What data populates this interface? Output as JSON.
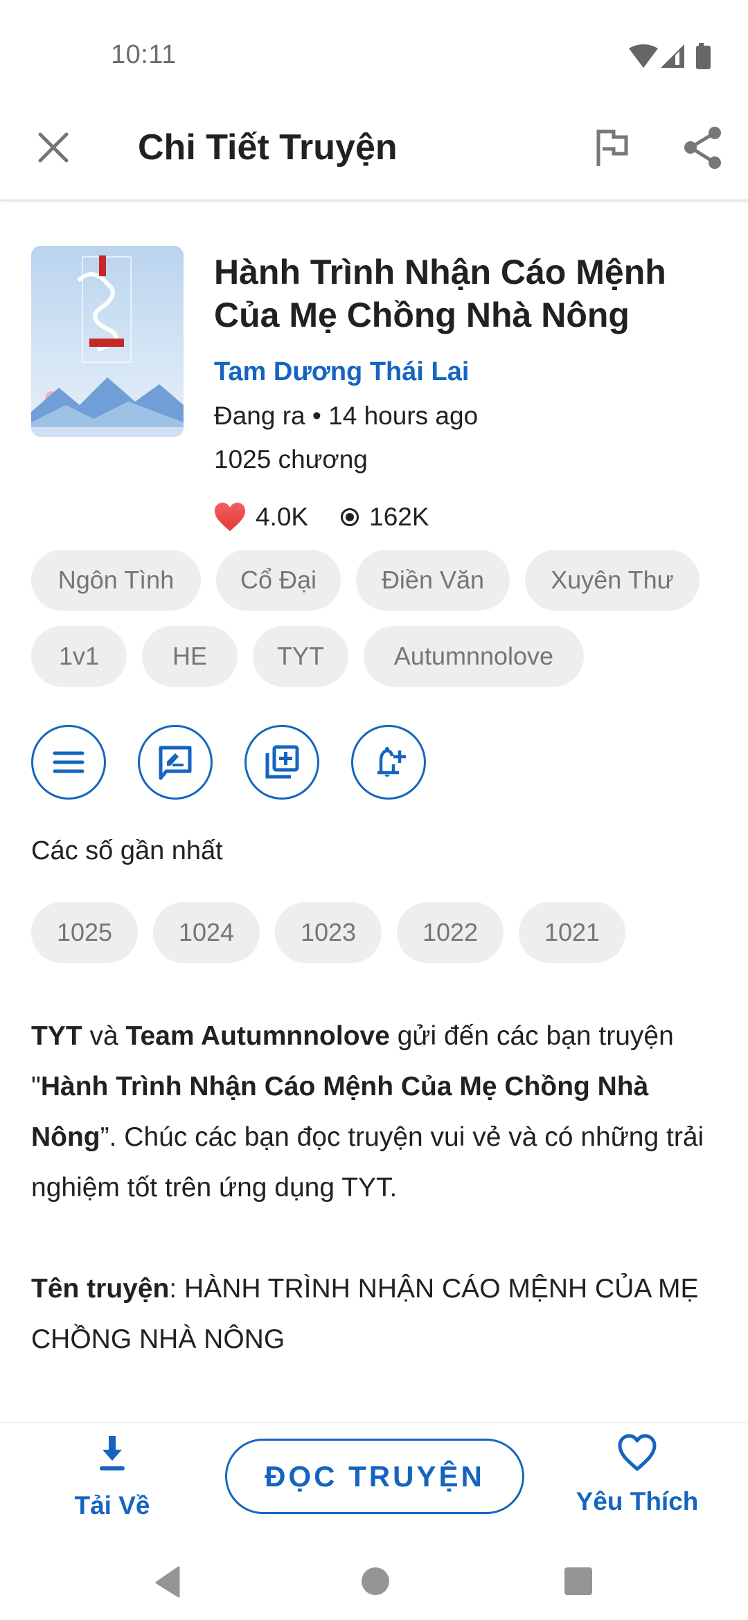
{
  "status_bar": {
    "time": "10:11",
    "icons": [
      "wifi-icon",
      "cell-signal-icon",
      "battery-icon"
    ]
  },
  "app_bar": {
    "title": "Chi Tiết Truyện",
    "close_icon": "close-icon",
    "report_icon": "flag-icon",
    "share_icon": "share-icon"
  },
  "book": {
    "title": "Hành Trình Nhận Cáo Mệnh Của Mẹ Chồng Nhà Nông",
    "author": "Tam Dương Thái Lai",
    "status": "Đang ra • 14 hours ago",
    "chapters": "1025 chương",
    "likes": "4.0K",
    "views": "162K",
    "cover_alt": "Book cover: Hành Trình Nhận Cáo Mệnh Của Mẹ Chồng Nhà Nông"
  },
  "tags": [
    "Ngôn Tình",
    "Cổ Đại",
    "Điền Văn",
    "Xuyên Thư",
    "1v1",
    "HE",
    "TYT",
    "Autumnnolove"
  ],
  "actions": [
    {
      "name": "chapter-list",
      "icon": "menu-icon"
    },
    {
      "name": "comment",
      "icon": "rate-review-icon"
    },
    {
      "name": "add-to-library",
      "icon": "library-add-icon"
    },
    {
      "name": "subscribe-notification",
      "icon": "bell-plus-icon"
    }
  ],
  "recent": {
    "label": "Các số gần nhất",
    "chapters": [
      "1025",
      "1024",
      "1023",
      "1022",
      "1021"
    ]
  },
  "description": {
    "p1": {
      "b1": "TYT",
      "t1": " và ",
      "b2": "Team Autumnnolove",
      "t2": " gửi đến các bạn truyện \"",
      "b3": "Hành Trình Nhận Cáo Mệnh Của Mẹ Chồng Nhà Nông",
      "t3": "”. Chúc các bạn đọc truyện vui vẻ và có những trải nghiệm tốt trên ứng dụng TYT."
    },
    "p2": {
      "label": "Tên truyện",
      "value": ": HÀNH TRÌNH NHẬN CÁO MỆNH CỦA MẸ CHỒNG NHÀ NÔNG"
    }
  },
  "bottom_bar": {
    "download_label": "Tải Về",
    "read_label": "ĐỌC TRUYỆN",
    "favorite_label": "Yêu Thích"
  },
  "colors": {
    "accent": "#1565c0",
    "chip_bg": "#eeeeee",
    "chip_text": "#757575",
    "heart": "#ef5350"
  }
}
